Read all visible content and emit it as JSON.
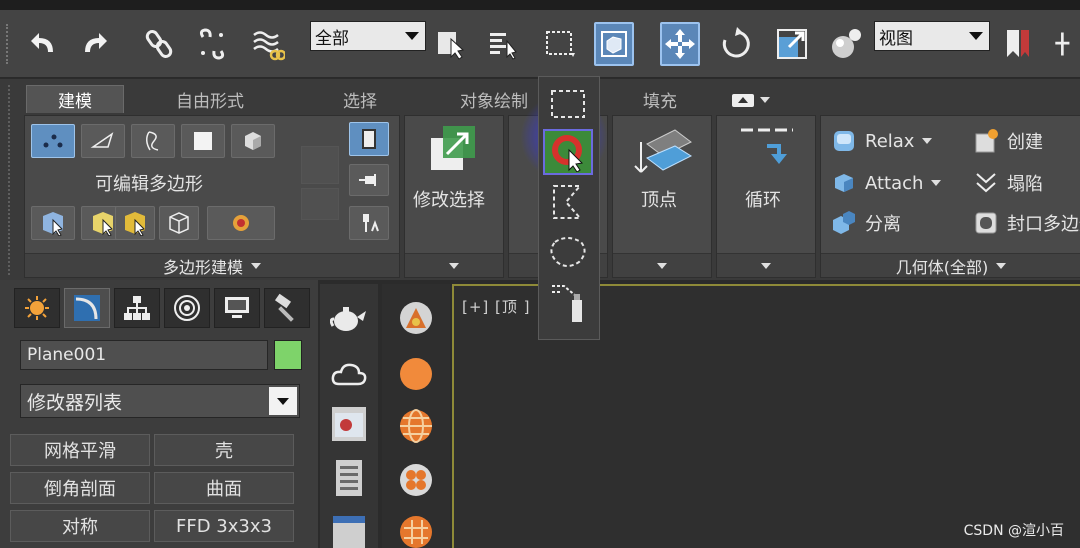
{
  "toolbar": {
    "selection_filter": "全部",
    "reference_coord": "视图",
    "buttons": [
      "undo-icon",
      "redo-icon",
      "link-icon",
      "unlink-icon",
      "bind-space-warp-icon",
      "select-object-icon",
      "select-by-name-icon",
      "rectangle-selection-icon",
      "window-crossing-icon",
      "move-icon",
      "rotate-icon",
      "scale-icon",
      "material-icon",
      "named-selection-icon",
      "mirror-icon"
    ]
  },
  "ribbon": {
    "tabs": [
      "建模",
      "自由形式",
      "选择",
      "对象绘制",
      "填充"
    ],
    "active_tab": "建模",
    "panels": {
      "polygon_modeling": {
        "title": "可编辑多边形",
        "footer": "多边形建模"
      },
      "modify_selection": {
        "label": "修改选择"
      },
      "vertex": {
        "label": "顶点"
      },
      "loop": {
        "label": "循环"
      },
      "geometry": {
        "footer": "几何体(全部)",
        "items": [
          "Relax",
          "Attach",
          "分离",
          "创建",
          "塌陷",
          "封口多边形"
        ]
      }
    }
  },
  "command_panel": {
    "object_name": "Plane001",
    "object_color": "#7ed36a",
    "modifier_list": "修改器列表",
    "modifiers": [
      "网格平滑",
      "壳",
      "倒角剖面",
      "曲面",
      "对称",
      "FFD 3x3x3"
    ]
  },
  "viewport": {
    "label": "[+] [顶 ]"
  },
  "watermark": "CSDN @渲小百",
  "colors": {
    "accent": "#5b87b8",
    "object_green": "#7ed36a",
    "viewport_border": "#8e8a38"
  }
}
